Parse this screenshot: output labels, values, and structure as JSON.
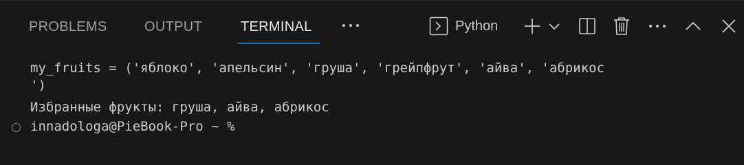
{
  "tabs": {
    "problems": "PROBLEMS",
    "output": "OUTPUT",
    "terminal": "TERMINAL",
    "more": "···"
  },
  "toolbar": {
    "profile_label": "Python",
    "profile_icon": "terminal-icon",
    "add_icon": "plus-icon",
    "dropdown_icon": "chevron-down-icon",
    "split_icon": "split-terminal-icon",
    "delete_icon": "trash-icon",
    "more_icon": "ellipsis-icon",
    "maximize_icon": "chevron-up-icon",
    "close_icon": "close-icon"
  },
  "terminal": {
    "lines": [
      "my_fruits = ('яблоко', 'апельсин', 'груша', 'грейпфрут', 'айва', 'абрикос",
      "')",
      "Избранные фрукты: груша, айва, абрикос",
      "innadologa@PieBook-Pro ~ %"
    ]
  },
  "colors": {
    "background": "#181818",
    "text": "#cccccc",
    "inactive_tab": "#9d9d9d",
    "active_accent": "#0078d4"
  }
}
